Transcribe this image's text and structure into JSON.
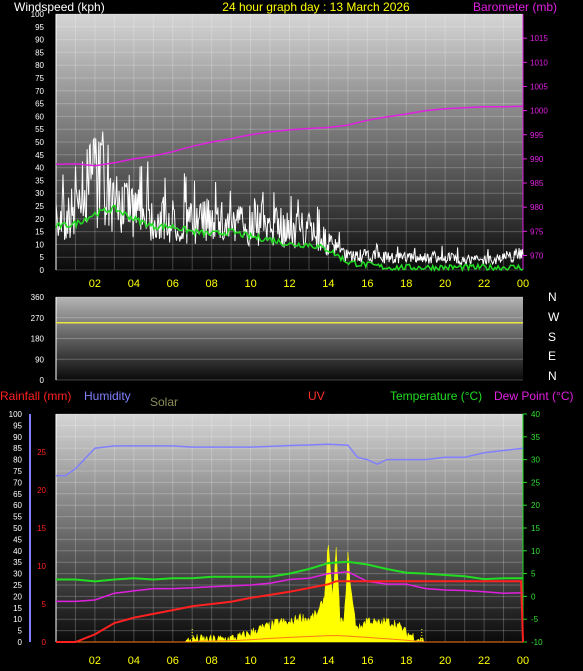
{
  "header": {
    "wind_label": "Windspeed (kph)",
    "title": "24 hour graph day : 13 March 2026",
    "baro_label": "Barometer (mb)"
  },
  "colors": {
    "wind": "#ffffff",
    "gust": "#ffffff",
    "avg": "#22dd22",
    "baro": "#e020e0",
    "dir": "#e8e840",
    "hum": "#8080ff",
    "temp": "#22dd22",
    "dew": "#e020e0",
    "rain": "#ff2020",
    "solar": "#ffff00",
    "uv": "#ff3030",
    "title": "#ffff00",
    "baro_label": "#e020e0",
    "wind_label": "#ffffff",
    "rain_label": "#ff2020",
    "hum_label": "#8080ff",
    "solar_label": "#8c8c5a",
    "uv_label": "#ff3030",
    "temp_label": "#22dd22",
    "dew_label": "#e020e0"
  },
  "hour_labels": [
    "02",
    "04",
    "06",
    "08",
    "10",
    "12",
    "14",
    "16",
    "18",
    "20",
    "22",
    "00"
  ],
  "compass": [
    "N",
    "W",
    "S",
    "E",
    "N"
  ],
  "lower_header": {
    "rain_label": "Rainfall (mm)",
    "hum_label": "Humidity",
    "solar_label": "Solar",
    "uv_label": "UV",
    "temp_label": "Temperature (°C)",
    "dew_label": "Dew Point (°C)"
  },
  "chart_data": [
    {
      "type": "line",
      "title": "24 hour graph day : 13 March 2026",
      "x_range_hours": [
        0,
        24
      ],
      "ylabel": "Windspeed (kph)",
      "ylim": [
        0,
        100
      ],
      "yticks": [
        0,
        5,
        10,
        15,
        20,
        25,
        30,
        35,
        40,
        45,
        50,
        55,
        60,
        65,
        70,
        75,
        80,
        85,
        90,
        95,
        100
      ],
      "y2label": "Barometer (mb)",
      "y2lim": [
        967,
        1020
      ],
      "y2ticks": [
        970,
        975,
        980,
        985,
        990,
        995,
        1000,
        1005,
        1010,
        1015
      ],
      "series": [
        {
          "name": "Wind gust",
          "axis": "y",
          "x": [
            0,
            1,
            2,
            3,
            4,
            5,
            6,
            7,
            8,
            9,
            10,
            11,
            12,
            13,
            14,
            15,
            16,
            17,
            18,
            19,
            20,
            21,
            22,
            23,
            24
          ],
          "y": [
            25,
            35,
            45,
            38,
            32,
            30,
            28,
            27,
            28,
            26,
            27,
            25,
            24,
            23,
            15,
            8,
            8,
            7,
            7,
            7,
            7,
            6,
            6,
            7,
            10
          ]
        },
        {
          "name": "Wind average",
          "axis": "y",
          "x": [
            0,
            1,
            2,
            3,
            4,
            5,
            6,
            7,
            8,
            9,
            10,
            11,
            12,
            13,
            14,
            15,
            16,
            17,
            18,
            19,
            20,
            21,
            22,
            23,
            24
          ],
          "y": [
            17,
            18,
            22,
            24,
            20,
            17,
            17,
            15,
            14,
            15,
            13,
            12,
            10,
            10,
            8,
            3,
            2,
            1,
            1,
            1,
            1,
            1,
            1,
            1,
            1
          ]
        },
        {
          "name": "Barometer",
          "axis": "y2",
          "x": [
            0,
            1,
            2,
            3,
            4,
            5,
            6,
            7,
            8,
            9,
            10,
            11,
            12,
            13,
            14,
            15,
            16,
            17,
            18,
            19,
            20,
            21,
            22,
            23,
            24
          ],
          "y": [
            988.9,
            989,
            988.6,
            989.2,
            990,
            990.6,
            991.5,
            992.6,
            993.5,
            994.2,
            995,
            995.6,
            996,
            996.3,
            996.5,
            997,
            998,
            998.7,
            999.3,
            1000,
            1000.4,
            1000.6,
            1000.8,
            1000.8,
            1000.9
          ]
        }
      ]
    },
    {
      "type": "line",
      "x_range_hours": [
        0,
        24
      ],
      "ylim": [
        0,
        360
      ],
      "yticks": [
        0,
        90,
        180,
        270,
        360
      ],
      "compass_labels": [
        "N",
        "W",
        "S",
        "E",
        "N"
      ],
      "series": [
        {
          "name": "Wind direction",
          "x": [
            0,
            24
          ],
          "y": [
            248,
            248
          ]
        }
      ]
    },
    {
      "type": "line",
      "x_range_hours": [
        0,
        24
      ],
      "ylim": [
        0,
        100
      ],
      "yticks": [
        0,
        5,
        10,
        15,
        20,
        25,
        30,
        35,
        40,
        45,
        50,
        55,
        60,
        65,
        70,
        75,
        80,
        85,
        90,
        95,
        100
      ],
      "y_rain_ticks": [
        0,
        5,
        10,
        15,
        20,
        25
      ],
      "y2lim": [
        -10,
        40
      ],
      "y2ticks": [
        -10,
        -5,
        0,
        5,
        10,
        15,
        20,
        25,
        30,
        35,
        40
      ],
      "series": [
        {
          "name": "Humidity",
          "axis": "pct",
          "x": [
            0,
            0.5,
            1,
            2,
            3,
            4,
            5,
            6,
            7,
            8,
            9,
            10,
            11,
            12,
            13,
            14,
            15,
            15.5,
            16,
            16.5,
            17,
            18,
            19,
            20,
            21,
            22,
            23,
            24
          ],
          "y": [
            73,
            73,
            76,
            85,
            86,
            86,
            86,
            86,
            85.5,
            85.5,
            85.5,
            85.5,
            85.8,
            86.2,
            86.4,
            86.7,
            86.3,
            81,
            80,
            78,
            80,
            80,
            80,
            81,
            81,
            83,
            84,
            85
          ]
        },
        {
          "name": "Temperature",
          "axis": "temp",
          "x": [
            0,
            1,
            2,
            3,
            4,
            5,
            6,
            7,
            8,
            9,
            10,
            11,
            12,
            13,
            14,
            15,
            16,
            17,
            18,
            19,
            20,
            21,
            22,
            23,
            24
          ],
          "y": [
            3.7,
            3.7,
            3.3,
            3.7,
            4,
            3.7,
            4,
            4,
            4.3,
            4.3,
            4.3,
            4.3,
            5,
            6,
            7.3,
            7.6,
            7,
            6,
            5.2,
            5,
            4.7,
            4.4,
            3.8,
            4,
            4
          ]
        },
        {
          "name": "Dew Point",
          "axis": "temp",
          "x": [
            0,
            1,
            2,
            3,
            4,
            5,
            6,
            7,
            8,
            9,
            10,
            11,
            12,
            13,
            14,
            15,
            16,
            17,
            18,
            19,
            20,
            21,
            22,
            23,
            24
          ],
          "y": [
            -1.1,
            -1.1,
            -0.8,
            0.7,
            1.2,
            1.7,
            1.7,
            1.9,
            2.1,
            2.3,
            2.5,
            2.9,
            3.7,
            4,
            5,
            5.4,
            3.3,
            2.7,
            2.7,
            1.7,
            1.4,
            1.3,
            1,
            0.7,
            0.8
          ]
        },
        {
          "name": "Rainfall",
          "axis": "rain",
          "x": [
            0,
            1,
            2,
            3,
            4,
            5,
            6,
            7,
            8,
            9,
            10,
            11,
            12,
            13,
            14,
            14.4,
            15,
            16,
            17,
            18,
            19,
            20,
            21,
            22,
            23,
            23.9,
            24
          ],
          "y": [
            0,
            0,
            1,
            2.5,
            3.2,
            3.7,
            4.2,
            4.7,
            5,
            5.3,
            5.8,
            6.2,
            6.6,
            7.1,
            7.6,
            8,
            8,
            8,
            8,
            8,
            8,
            8,
            8,
            8,
            8,
            8,
            0
          ]
        },
        {
          "name": "Solar",
          "axis": "temp",
          "x": [
            0,
            6.6,
            7.1,
            8,
            9,
            9.5,
            10,
            10.5,
            11,
            11.5,
            12,
            12.5,
            13,
            13.5,
            13.8,
            14,
            14.2,
            14.4,
            14.6,
            14.8,
            15,
            15.2,
            15.4,
            15.6,
            16,
            16.5,
            17,
            17.5,
            18,
            18.5,
            19,
            24
          ],
          "y": [
            -10,
            -10,
            -9.3,
            -9.5,
            -9.2,
            -8.8,
            -8,
            -7,
            -6.5,
            -5.5,
            -6,
            -4.5,
            -5,
            -3.5,
            0,
            12,
            -1,
            10,
            -5,
            -6,
            9,
            0,
            -6,
            -7,
            -5,
            -6,
            -5.5,
            -6,
            -8,
            -9,
            -10,
            -10
          ]
        },
        {
          "name": "UV",
          "axis": "temp",
          "x": [
            0,
            7,
            7.5,
            8,
            9,
            10,
            11,
            12,
            13,
            14,
            14.5,
            15,
            16,
            17,
            18,
            18.5,
            19,
            24
          ],
          "y": [
            -10,
            -10,
            -9.8,
            -9.8,
            -9.7,
            -9.5,
            -9.2,
            -9,
            -8.8,
            -8.6,
            -8.6,
            -8.7,
            -9,
            -9.3,
            -9.6,
            -9.8,
            -10,
            -10
          ]
        }
      ]
    }
  ]
}
